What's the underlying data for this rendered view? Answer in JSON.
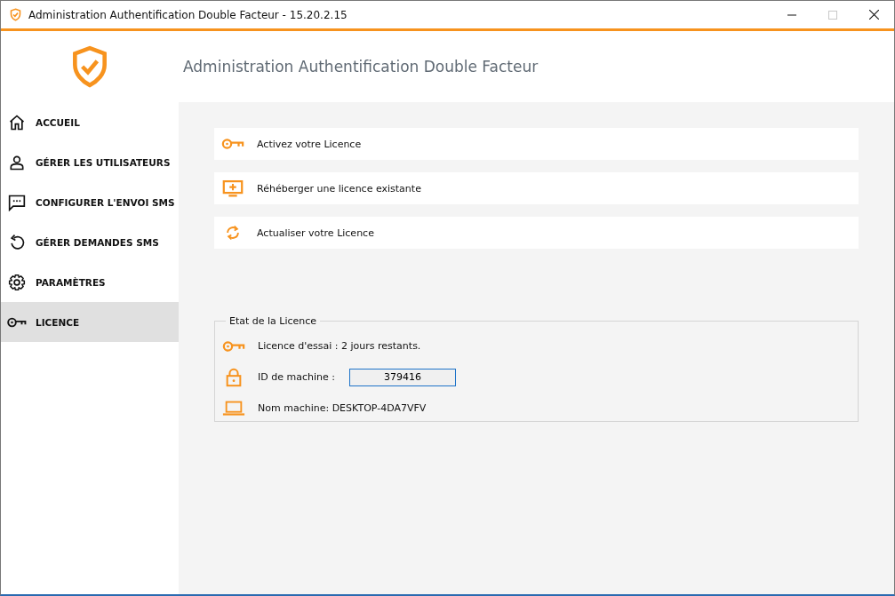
{
  "window": {
    "title": "Administration Authentification Double Facteur - 15.20.2.15",
    "controls": [
      {
        "kind": "minimize",
        "disabled": false
      },
      {
        "kind": "maximize",
        "disabled": true
      },
      {
        "kind": "close",
        "disabled": false
      }
    ]
  },
  "header": {
    "title": "Administration Authentification Double Facteur"
  },
  "sidebar": {
    "items": [
      {
        "kind": "home",
        "label": "ACCUEIL",
        "selected": false
      },
      {
        "kind": "user",
        "label": "GÉRER LES UTILISATEURS",
        "selected": false
      },
      {
        "kind": "chat",
        "label": "CONFIGURER L'ENVOI SMS",
        "selected": false
      },
      {
        "kind": "undo",
        "label": "GÉRER DEMANDES SMS",
        "selected": false
      },
      {
        "kind": "gear",
        "label": "PARAMÈTRES",
        "selected": false
      },
      {
        "kind": "key",
        "label": "LICENCE",
        "selected": true
      }
    ]
  },
  "actions": [
    {
      "kind": "key",
      "label": "Activez votre Licence"
    },
    {
      "kind": "monitor",
      "label": "Réhéberger une licence existante"
    },
    {
      "kind": "refresh",
      "label": "Actualiser votre Licence"
    }
  ],
  "license_status": {
    "title": "Etat de la Licence",
    "rows": [
      {
        "kind": "key",
        "label": "Licence d'essai : 2 jours restants."
      },
      {
        "kind": "lock",
        "label": "ID de machine :",
        "value": "379416"
      },
      {
        "kind": "laptop",
        "label": "Nom machine: DESKTOP-4DA7VFV"
      }
    ]
  }
}
